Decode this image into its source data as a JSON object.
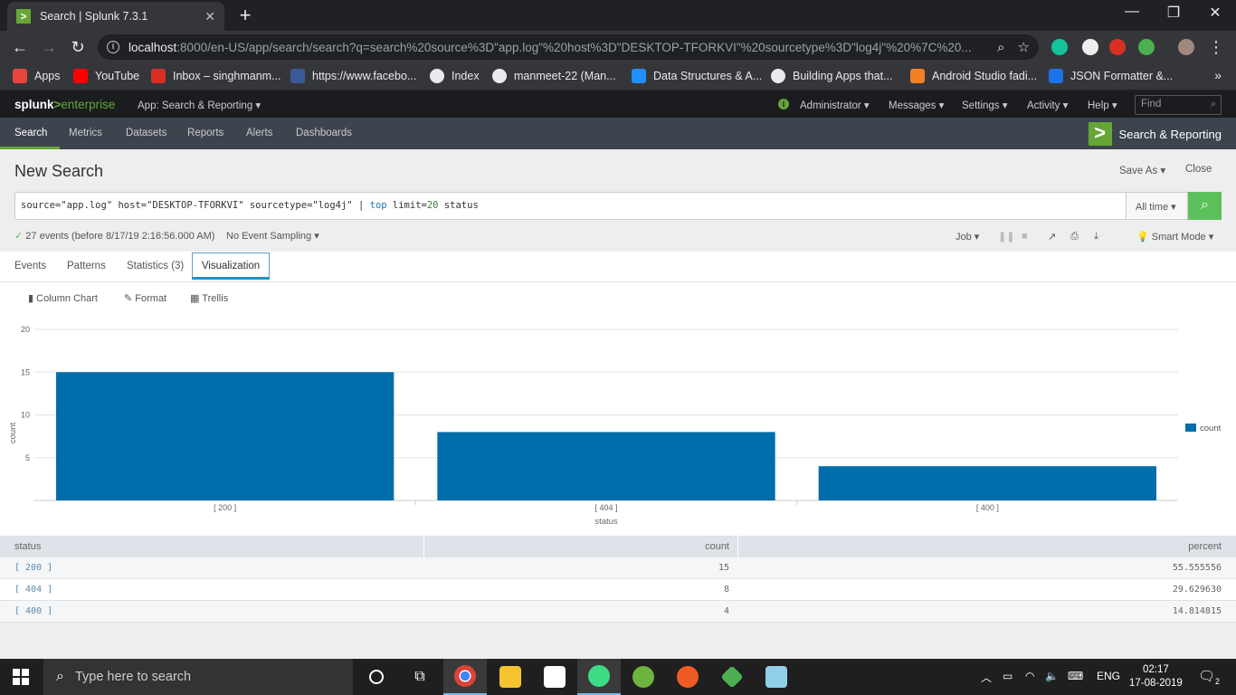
{
  "browser": {
    "tab_title": "Search | Splunk 7.3.1",
    "tab_favicon": ">",
    "url_host": "localhost",
    "url_rest": ":8000/en-US/app/search/search?q=search%20source%3D\"app.log\"%20host%3D\"DESKTOP-TFORKVI\"%20sourcetype%3D\"log4j\"%20%7C%20...",
    "bookmarks": [
      {
        "label": "Apps",
        "color": "#e8453c"
      },
      {
        "label": "YouTube",
        "color": "#ff0000"
      },
      {
        "label": "Inbox – singhmanm...",
        "color": "#d93025"
      },
      {
        "label": "https://www.facebo...",
        "color": "#3b5998"
      },
      {
        "label": "Index",
        "color": "#e8eaed"
      },
      {
        "label": "manmeet-22 (Man...",
        "color": "#e8eaed"
      },
      {
        "label": "Data Structures & A...",
        "color": "#1e90ff"
      },
      {
        "label": "Building Apps that...",
        "color": "#e8eaed"
      },
      {
        "label": "Android Studio fadi...",
        "color": "#f48024"
      },
      {
        "label": "JSON Formatter &...",
        "color": "#1a73e8"
      }
    ]
  },
  "splunk": {
    "logo_brand": "splunk",
    "logo_gt": ">",
    "logo_product": "enterprise",
    "app_menu": "App: Search & Reporting ▾",
    "top_menu": [
      "Administrator ▾",
      "Messages ▾",
      "Settings ▾",
      "Activity ▾",
      "Help ▾"
    ],
    "find_placeholder": "Find",
    "nav": [
      "Search",
      "Metrics",
      "Datasets",
      "Reports",
      "Alerts",
      "Dashboards"
    ],
    "app_badge": "Search & Reporting"
  },
  "search": {
    "page_title": "New Search",
    "save_as": "Save As ▾",
    "close": "Close",
    "query_prefix": "source=\"app.log\" host=\"DESKTOP-TFORKVI\" sourcetype=\"log4j\" | ",
    "query_cmd": "top",
    "query_arg": " limit=",
    "query_arg_val": "20",
    "query_field": " status",
    "time_range": "All time ▾",
    "status_check": "✓",
    "status_text": "27 events (before 8/17/19 2:16:56.000 AM)",
    "sampling": "No Event Sampling ▾",
    "job": "Job ▾",
    "smart_mode": "Smart Mode ▾"
  },
  "tabs": [
    "Events",
    "Patterns",
    "Statistics (3)",
    "Visualization"
  ],
  "viz_tools": [
    "Column Chart",
    "Format",
    "Trellis"
  ],
  "chart_data": {
    "type": "bar",
    "categories": [
      "[ 200 ]",
      "[ 404 ]",
      "[ 400 ]"
    ],
    "series": [
      {
        "name": "count",
        "values": [
          15,
          8,
          4
        ],
        "color": "#006eaa"
      }
    ],
    "xlabel": "status",
    "ylabel": "count",
    "ylim": [
      0,
      20
    ],
    "yticks": [
      5,
      10,
      15,
      20
    ],
    "grid": true,
    "legend": "right"
  },
  "table": {
    "headers": [
      "status",
      "count",
      "percent"
    ],
    "rows": [
      [
        "[ 200 ]",
        "15",
        "55.555556"
      ],
      [
        "[ 404 ]",
        "8",
        "29.629630"
      ],
      [
        "[ 400 ]",
        "4",
        "14.814815"
      ]
    ]
  },
  "taskbar": {
    "search_placeholder": "Type here to search",
    "lang": "ENG",
    "time": "02:17",
    "date": "17-08-2019",
    "notifications": "2"
  }
}
